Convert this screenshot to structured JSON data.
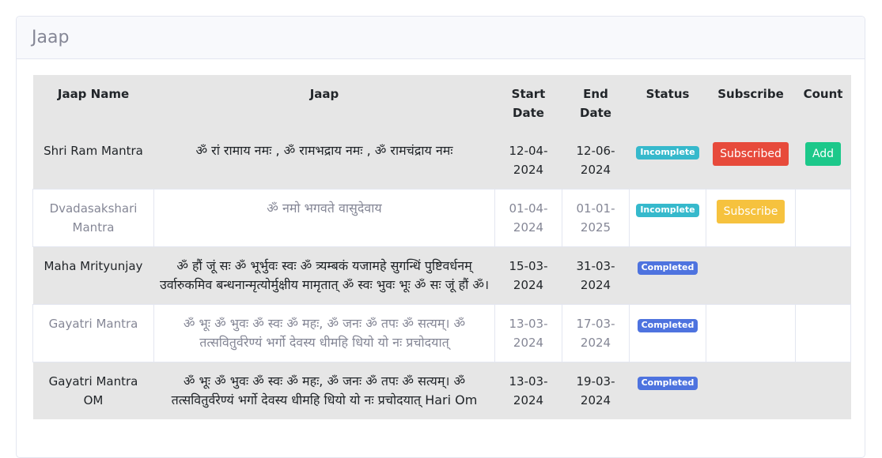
{
  "card": {
    "title": "Jaap"
  },
  "table": {
    "headers": [
      "Jaap Name",
      "Jaap",
      "Start Date",
      "End Date",
      "Status",
      "Subscribe",
      "Count"
    ],
    "rows": [
      {
        "name": "Shri Ram Mantra",
        "jaap": "ॐ रां रामाय नमः , ॐ रामभद्राय नमः , ॐ रामचंद्राय नमः",
        "start": "12-04-2024",
        "end": "12-06-2024",
        "status": "Incomplete",
        "subscribe": "Subscribed",
        "count": "Add"
      },
      {
        "name": "Dvadasakshari Mantra",
        "jaap": "ॐ नमो भगवते वासुदेवाय",
        "start": "01-04-2024",
        "end": "01-01-2025",
        "status": "Incomplete",
        "subscribe": "Subscribe",
        "count": ""
      },
      {
        "name": "Maha Mrityunjay",
        "jaap": "ॐ हौं जूं सः ॐ भूर्भुवः स्वः ॐ त्र्यम्बकं यजामहे सुगन्धिं पुष्टिवर्धनम् उर्वारुकमिव बन्धनान्मृत्योर्मुक्षीय मामृतात् ॐ स्वः भुवः भूः ॐ सः जूं हौं ॐ।",
        "start": "15-03-2024",
        "end": "31-03-2024",
        "status": "Completed",
        "subscribe": "",
        "count": ""
      },
      {
        "name": "Gayatri Mantra",
        "jaap": "ॐ भूः ॐ भुवः ॐ स्वः ॐ महः, ॐ जनः ॐ तपः ॐ सत्यम्। ॐ तत्सवितुर्वरेण्यं भर्गो देवस्य धीमहि धियो यो नः प्रचोदयात्",
        "start": "13-03-2024",
        "end": "17-03-2024",
        "status": "Completed",
        "subscribe": "",
        "count": ""
      },
      {
        "name": "Gayatri Mantra OM",
        "jaap": "ॐ भूः ॐ भुवः ॐ स्वः ॐ महः, ॐ जनः ॐ तपः ॐ सत्यम्। ॐ तत्सवितुर्वरेण्यं भर्गो देवस्य धीमहि धियो यो नः प्रचोदयात् Hari Om",
        "start": "13-03-2024",
        "end": "19-03-2024",
        "status": "Completed",
        "subscribe": "",
        "count": ""
      }
    ]
  }
}
